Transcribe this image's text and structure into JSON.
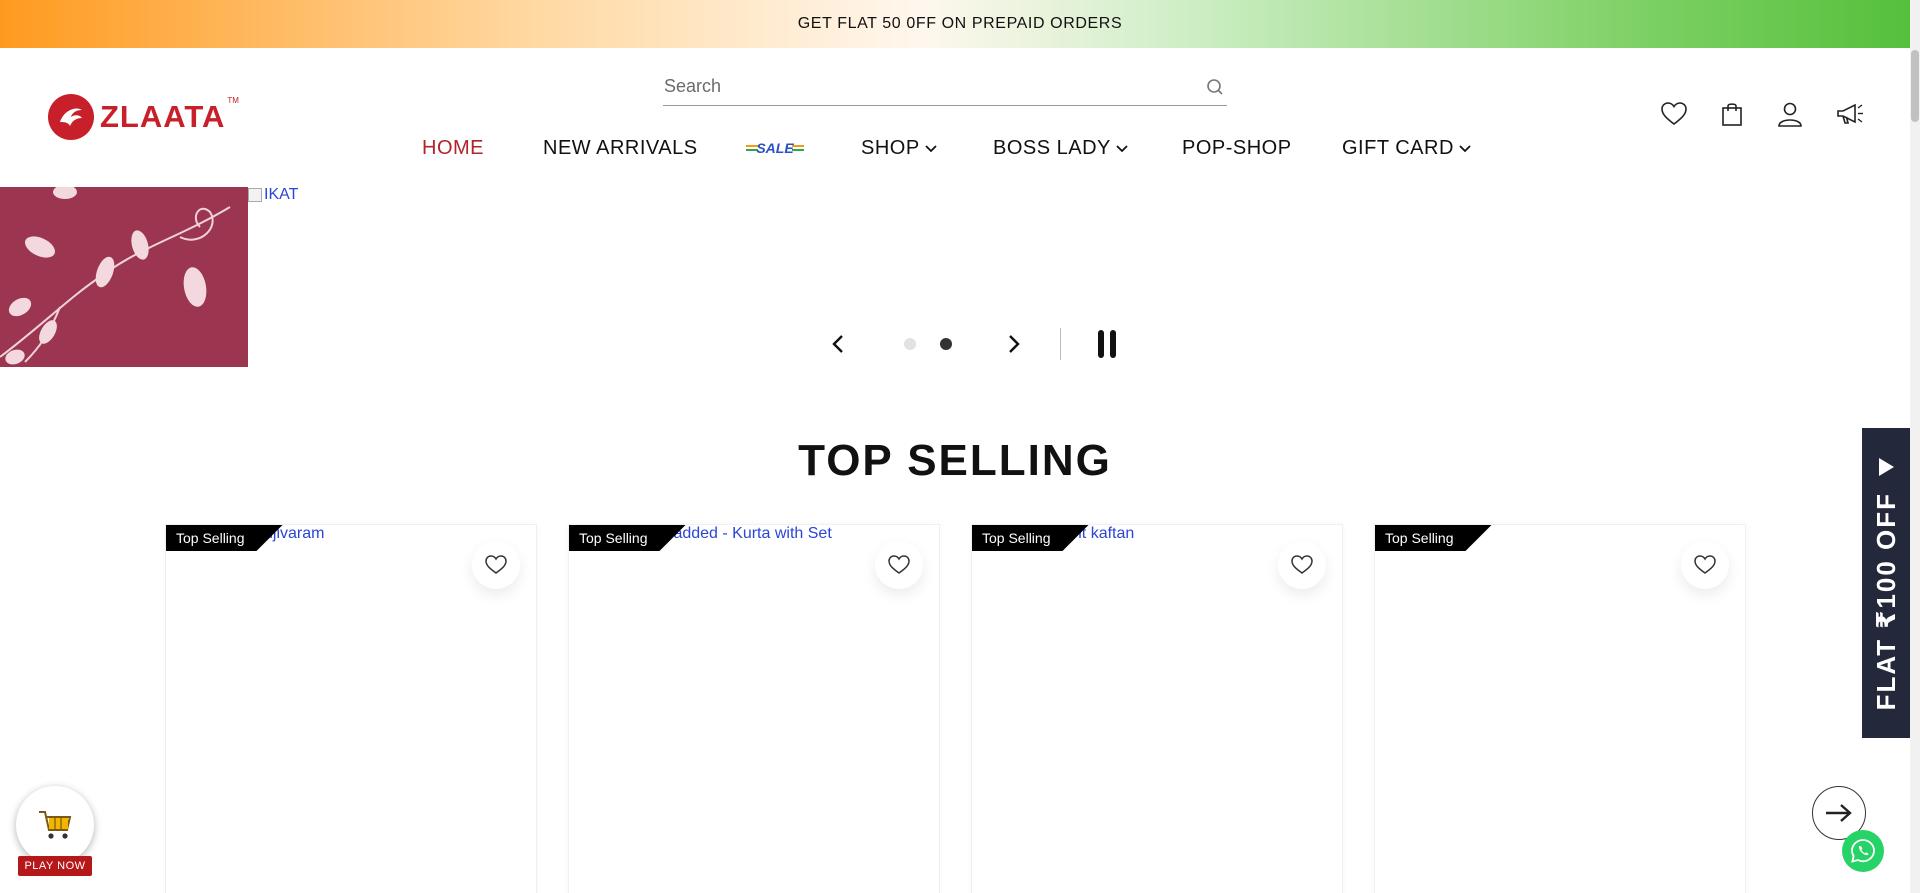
{
  "announcement": {
    "text": "GET FLAT 50 0FF ON PREPAID ORDERS"
  },
  "brand": {
    "name": "ZLAATA",
    "tm": "TM",
    "color": "#c8202a"
  },
  "search": {
    "placeholder": "Search",
    "value": ""
  },
  "nav": {
    "items": [
      {
        "label": "HOME",
        "active": true
      },
      {
        "label": "NEW ARRIVALS"
      },
      {
        "label": "SHOP",
        "dropdown": true
      },
      {
        "label": "BOSS LADY",
        "dropdown": true
      },
      {
        "label": "POP-SHOP"
      },
      {
        "label": "GIFT CARD",
        "dropdown": true
      }
    ],
    "sale_badge": "SALE",
    "active_color": "#b0242a"
  },
  "header_icons": [
    "heart-icon",
    "bag-icon",
    "user-icon",
    "megaphone-icon"
  ],
  "banner": {
    "alt_text": "IKAT",
    "slides": 2,
    "active_slide": 2
  },
  "section": {
    "title": "TOP SELLING"
  },
  "products": [
    {
      "tag": "Top Selling",
      "link_text": "njivaram"
    },
    {
      "tag": "Top Selling",
      "link_text": "y added - Kurta with Set"
    },
    {
      "tag": "Top Selling",
      "link_text": "ant kaftan"
    },
    {
      "tag": "Top Selling",
      "link_text": ""
    }
  ],
  "side_tab": {
    "text": "FLAT ₹100 OFF"
  },
  "play_widget": {
    "label": "PLAY NOW"
  }
}
